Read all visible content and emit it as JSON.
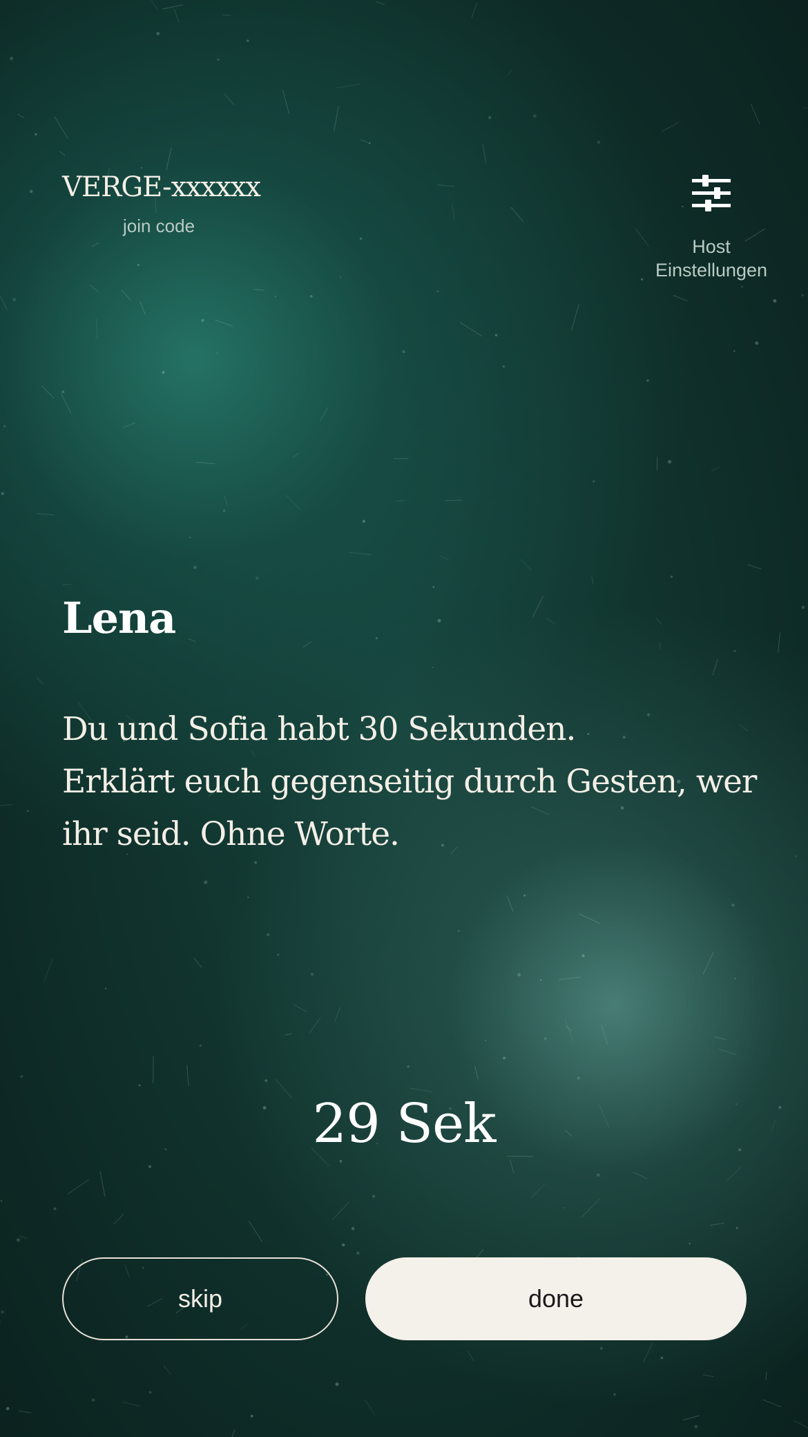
{
  "header": {
    "join_code": "VERGE-xxxxxx",
    "join_code_label": "join code",
    "settings_icon": "sliders-icon",
    "settings_label_line1": "Host",
    "settings_label_line2": "Einstellungen"
  },
  "main": {
    "player_name": "Lena",
    "prompt_lines": [
      "Du und Sofia habt 30 Sekunden.",
      "Erklärt euch gegenseitig durch Gesten, wer",
      "ihr seid. Ohne Worte."
    ]
  },
  "timer": {
    "text": "29 Sek"
  },
  "actions": {
    "skip_label": "skip",
    "done_label": "done"
  },
  "colors": {
    "background_dark": "#0f2a26",
    "glow_teal": "#287d6e",
    "text_light": "#f3efe6",
    "muted_text": "#b9cbc5",
    "done_button_bg": "#f4f0ea"
  }
}
